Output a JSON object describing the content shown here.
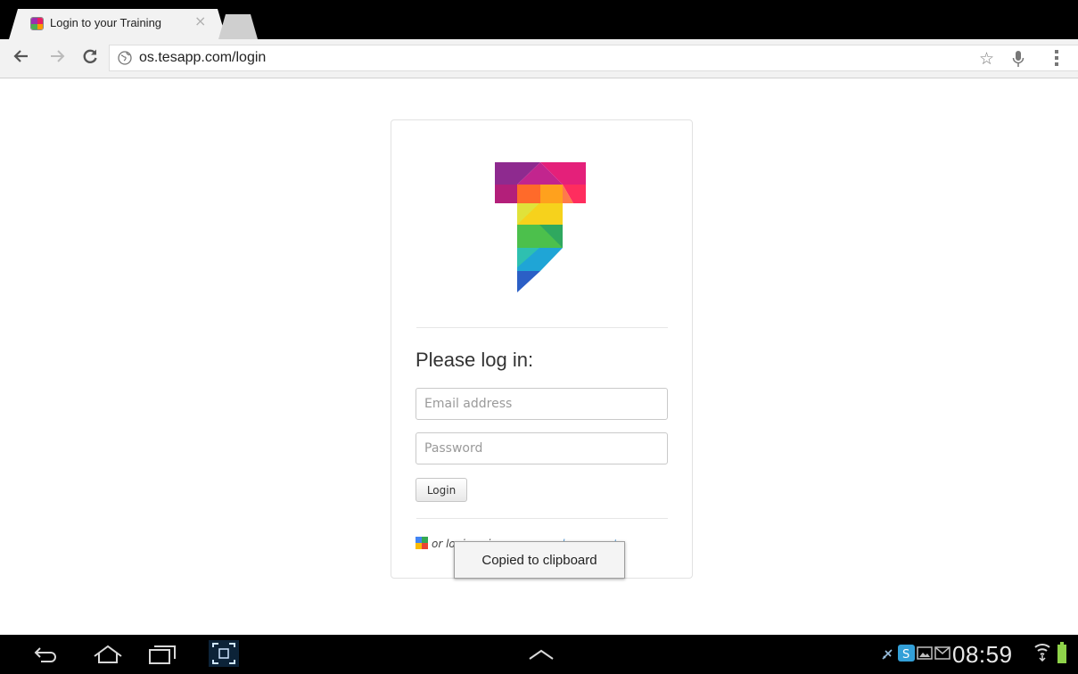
{
  "browser": {
    "tab": {
      "title": "Login to your Training",
      "close": "×"
    },
    "address": {
      "url": "os.tesapp.com/login"
    }
  },
  "login": {
    "heading": "Please log in:",
    "email_placeholder": "Email address",
    "password_placeholder": "Password",
    "login_button": "Login",
    "alt_prefix": "or login using your",
    "alt_link": "google account"
  },
  "toast": {
    "text": "Copied to clipboard"
  },
  "system": {
    "time": "08:59"
  },
  "colors": {
    "accent_link": "#5b9ed6",
    "battery": "#8fd34a",
    "status_blue": "#33a0d8"
  }
}
